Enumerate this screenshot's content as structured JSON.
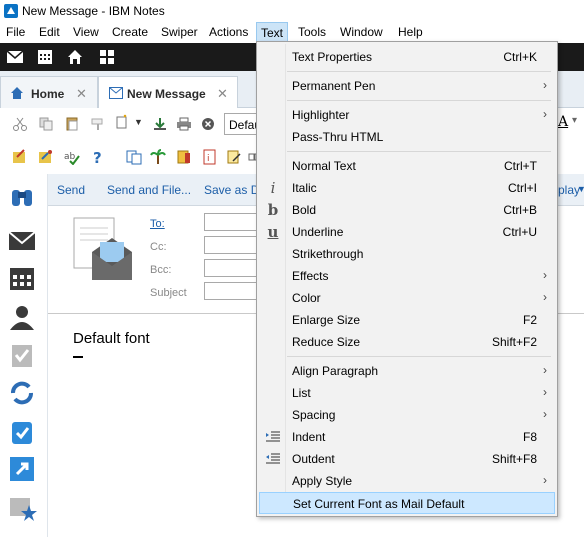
{
  "window": {
    "title": "New Message - IBM Notes"
  },
  "menubar": {
    "items": [
      {
        "label": "File"
      },
      {
        "label": "Edit"
      },
      {
        "label": "View"
      },
      {
        "label": "Create"
      },
      {
        "label": "Swiper"
      },
      {
        "label": "Actions"
      },
      {
        "label": "Text"
      },
      {
        "label": "Tools"
      },
      {
        "label": "Window"
      },
      {
        "label": "Help"
      }
    ]
  },
  "tabs": [
    {
      "label": "Home",
      "icon": "home-icon"
    },
    {
      "label": "New Message",
      "icon": "mail-icon"
    }
  ],
  "toolbar": {
    "font_field_value": "Defau",
    "right_glyph": "A"
  },
  "actionbar": {
    "send": "Send",
    "send_and_file": "Send and File...",
    "save_as_draft": "Save as D",
    "display": "play"
  },
  "address": {
    "to": "To:",
    "cc": "Cc:",
    "bcc": "Bcc:",
    "subject": "Subject"
  },
  "body": {
    "text": "Default font"
  },
  "text_menu": {
    "items": [
      {
        "label": "Text Properties",
        "shortcut": "Ctrl+K"
      },
      {
        "label": "Permanent Pen",
        "submenu": true
      },
      {
        "label": "Highlighter",
        "submenu": true
      },
      {
        "label": "Pass-Thru HTML"
      },
      {
        "label": "Normal Text",
        "shortcut": "Ctrl+T"
      },
      {
        "label": "Italic",
        "shortcut": "Ctrl+I",
        "icon_glyph": "i"
      },
      {
        "label": "Bold",
        "shortcut": "Ctrl+B",
        "icon_glyph": "b"
      },
      {
        "label": "Underline",
        "shortcut": "Ctrl+U",
        "icon_glyph": "u"
      },
      {
        "label": "Strikethrough"
      },
      {
        "label": "Effects",
        "submenu": true
      },
      {
        "label": "Color",
        "submenu": true
      },
      {
        "label": "Enlarge Size",
        "shortcut": "F2"
      },
      {
        "label": "Reduce Size",
        "shortcut": "Shift+F2"
      },
      {
        "label": "Align Paragraph",
        "submenu": true
      },
      {
        "label": "List",
        "submenu": true
      },
      {
        "label": "Spacing",
        "submenu": true
      },
      {
        "label": "Indent",
        "shortcut": "F8"
      },
      {
        "label": "Outdent",
        "shortcut": "Shift+F8"
      },
      {
        "label": "Apply Style",
        "submenu": true
      },
      {
        "label": "Set Current Font as Mail Default",
        "highlighted": true
      }
    ],
    "arrow": "›"
  },
  "colors": {
    "accent_link": "#1c5ea8",
    "menu_highlight": "#cde8ff",
    "dark_toolbar": "#1a1a1a"
  }
}
